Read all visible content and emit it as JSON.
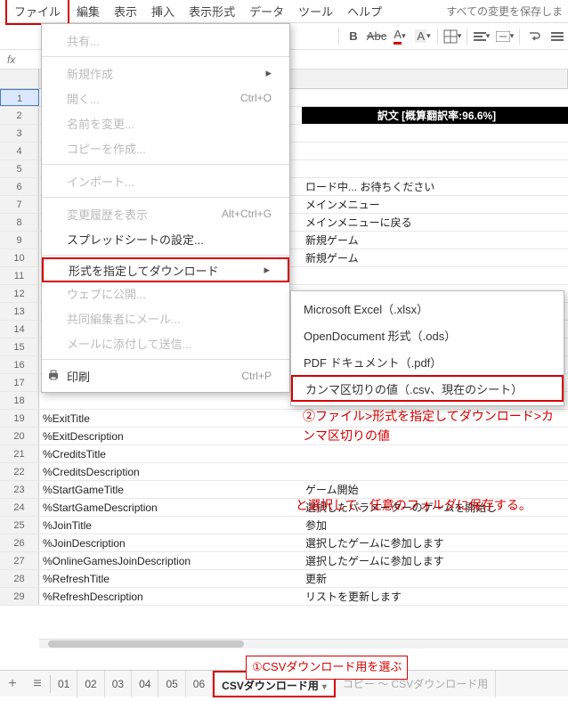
{
  "menubar": {
    "items": [
      "ファイル",
      "編集",
      "表示",
      "挿入",
      "表示形式",
      "データ",
      "ツール",
      "ヘルプ"
    ],
    "save_status": "すべての変更を保存しま"
  },
  "toolbar": {
    "bold": "B",
    "strike": "Abc",
    "text_color": "A",
    "fill_color": "A"
  },
  "formula_bar": {
    "fx": "fx"
  },
  "dropdown": {
    "share": "共有...",
    "new": "新規作成",
    "open": "開く...",
    "open_shortcut": "Ctrl+O",
    "rename": "名前を変更...",
    "make_copy": "コピーを作成...",
    "import": "インポート...",
    "revision": "変更履歴を表示",
    "revision_shortcut": "Alt+Ctrl+G",
    "spreadsheet_settings": "スプレッドシートの設定...",
    "download_as": "形式を指定してダウンロード",
    "publish": "ウェブに公開...",
    "email_collaborators": "共同編集者にメール...",
    "email_attachment": "メールに添付して送信...",
    "print": "印刷",
    "print_shortcut": "Ctrl+P"
  },
  "submenu": {
    "xlsx": "Microsoft Excel（.xlsx）",
    "ods": "OpenDocument 形式（.ods）",
    "pdf": "PDF ドキュメント（.pdf）",
    "csv": "カンマ区切りの値（.csv、現在のシート）"
  },
  "annotations": {
    "a1": "①CSVダウンロード用を選ぶ",
    "a2": "②ファイル>形式を指定してダウンロード>カンマ区切りの値",
    "a3": "と選択して、任意のフォルダに保存する。"
  },
  "sheet": {
    "black_header": "訳文 [概算翻訳率:96.6%]",
    "rows": [
      {
        "n": 1,
        "a": "",
        "b": ""
      },
      {
        "n": 2,
        "a": "",
        "b": ""
      },
      {
        "n": 3,
        "a": "",
        "b": ""
      },
      {
        "n": 4,
        "a": "",
        "b": ""
      },
      {
        "n": 5,
        "a": "",
        "b": ""
      },
      {
        "n": 6,
        "a": "",
        "b": "ロード中... お待ちください"
      },
      {
        "n": 7,
        "a": "",
        "b": "メインメニュー"
      },
      {
        "n": 8,
        "a": "",
        "b": "メインメニューに戻る"
      },
      {
        "n": 9,
        "a": "",
        "b": "新規ゲーム"
      },
      {
        "n": 10,
        "a": "",
        "b": "新規ゲーム"
      },
      {
        "n": 11,
        "a": "",
        "b": ""
      },
      {
        "n": 12,
        "a": "",
        "b": ""
      },
      {
        "n": 13,
        "a": "",
        "b": ""
      },
      {
        "n": 14,
        "a": "",
        "b": ""
      },
      {
        "n": 15,
        "a": "",
        "b": ""
      },
      {
        "n": 16,
        "a": "",
        "b": ""
      },
      {
        "n": 17,
        "a": "",
        "b": ""
      },
      {
        "n": 18,
        "a": "",
        "b": ""
      },
      {
        "n": 19,
        "a": "%ExitTitle",
        "b": ""
      },
      {
        "n": 20,
        "a": "%ExitDescription",
        "b": ""
      },
      {
        "n": 21,
        "a": "%CreditsTitle",
        "b": ""
      },
      {
        "n": 22,
        "a": "%CreditsDescription",
        "b": ""
      },
      {
        "n": 23,
        "a": "%StartGameTitle",
        "b": "ゲーム開始"
      },
      {
        "n": 24,
        "a": "%StartGameDescription",
        "b": "選択したパラメーターのゲームを開始し"
      },
      {
        "n": 25,
        "a": "%JoinTitle",
        "b": "参加"
      },
      {
        "n": 26,
        "a": "%JoinDescription",
        "b": "選択したゲームに参加します"
      },
      {
        "n": 27,
        "a": "%OnlineGamesJoinDescription",
        "b": "選択したゲームに参加します"
      },
      {
        "n": 28,
        "a": "%RefreshTitle",
        "b": "更新"
      },
      {
        "n": 29,
        "a": "%RefreshDescription",
        "b": "リストを更新します"
      }
    ]
  },
  "tabs": {
    "items": [
      "01",
      "02",
      "03",
      "04",
      "05",
      "06"
    ],
    "active": "CSVダウンロード用",
    "overflow": "コピー ～ CSVダウンロード用"
  }
}
